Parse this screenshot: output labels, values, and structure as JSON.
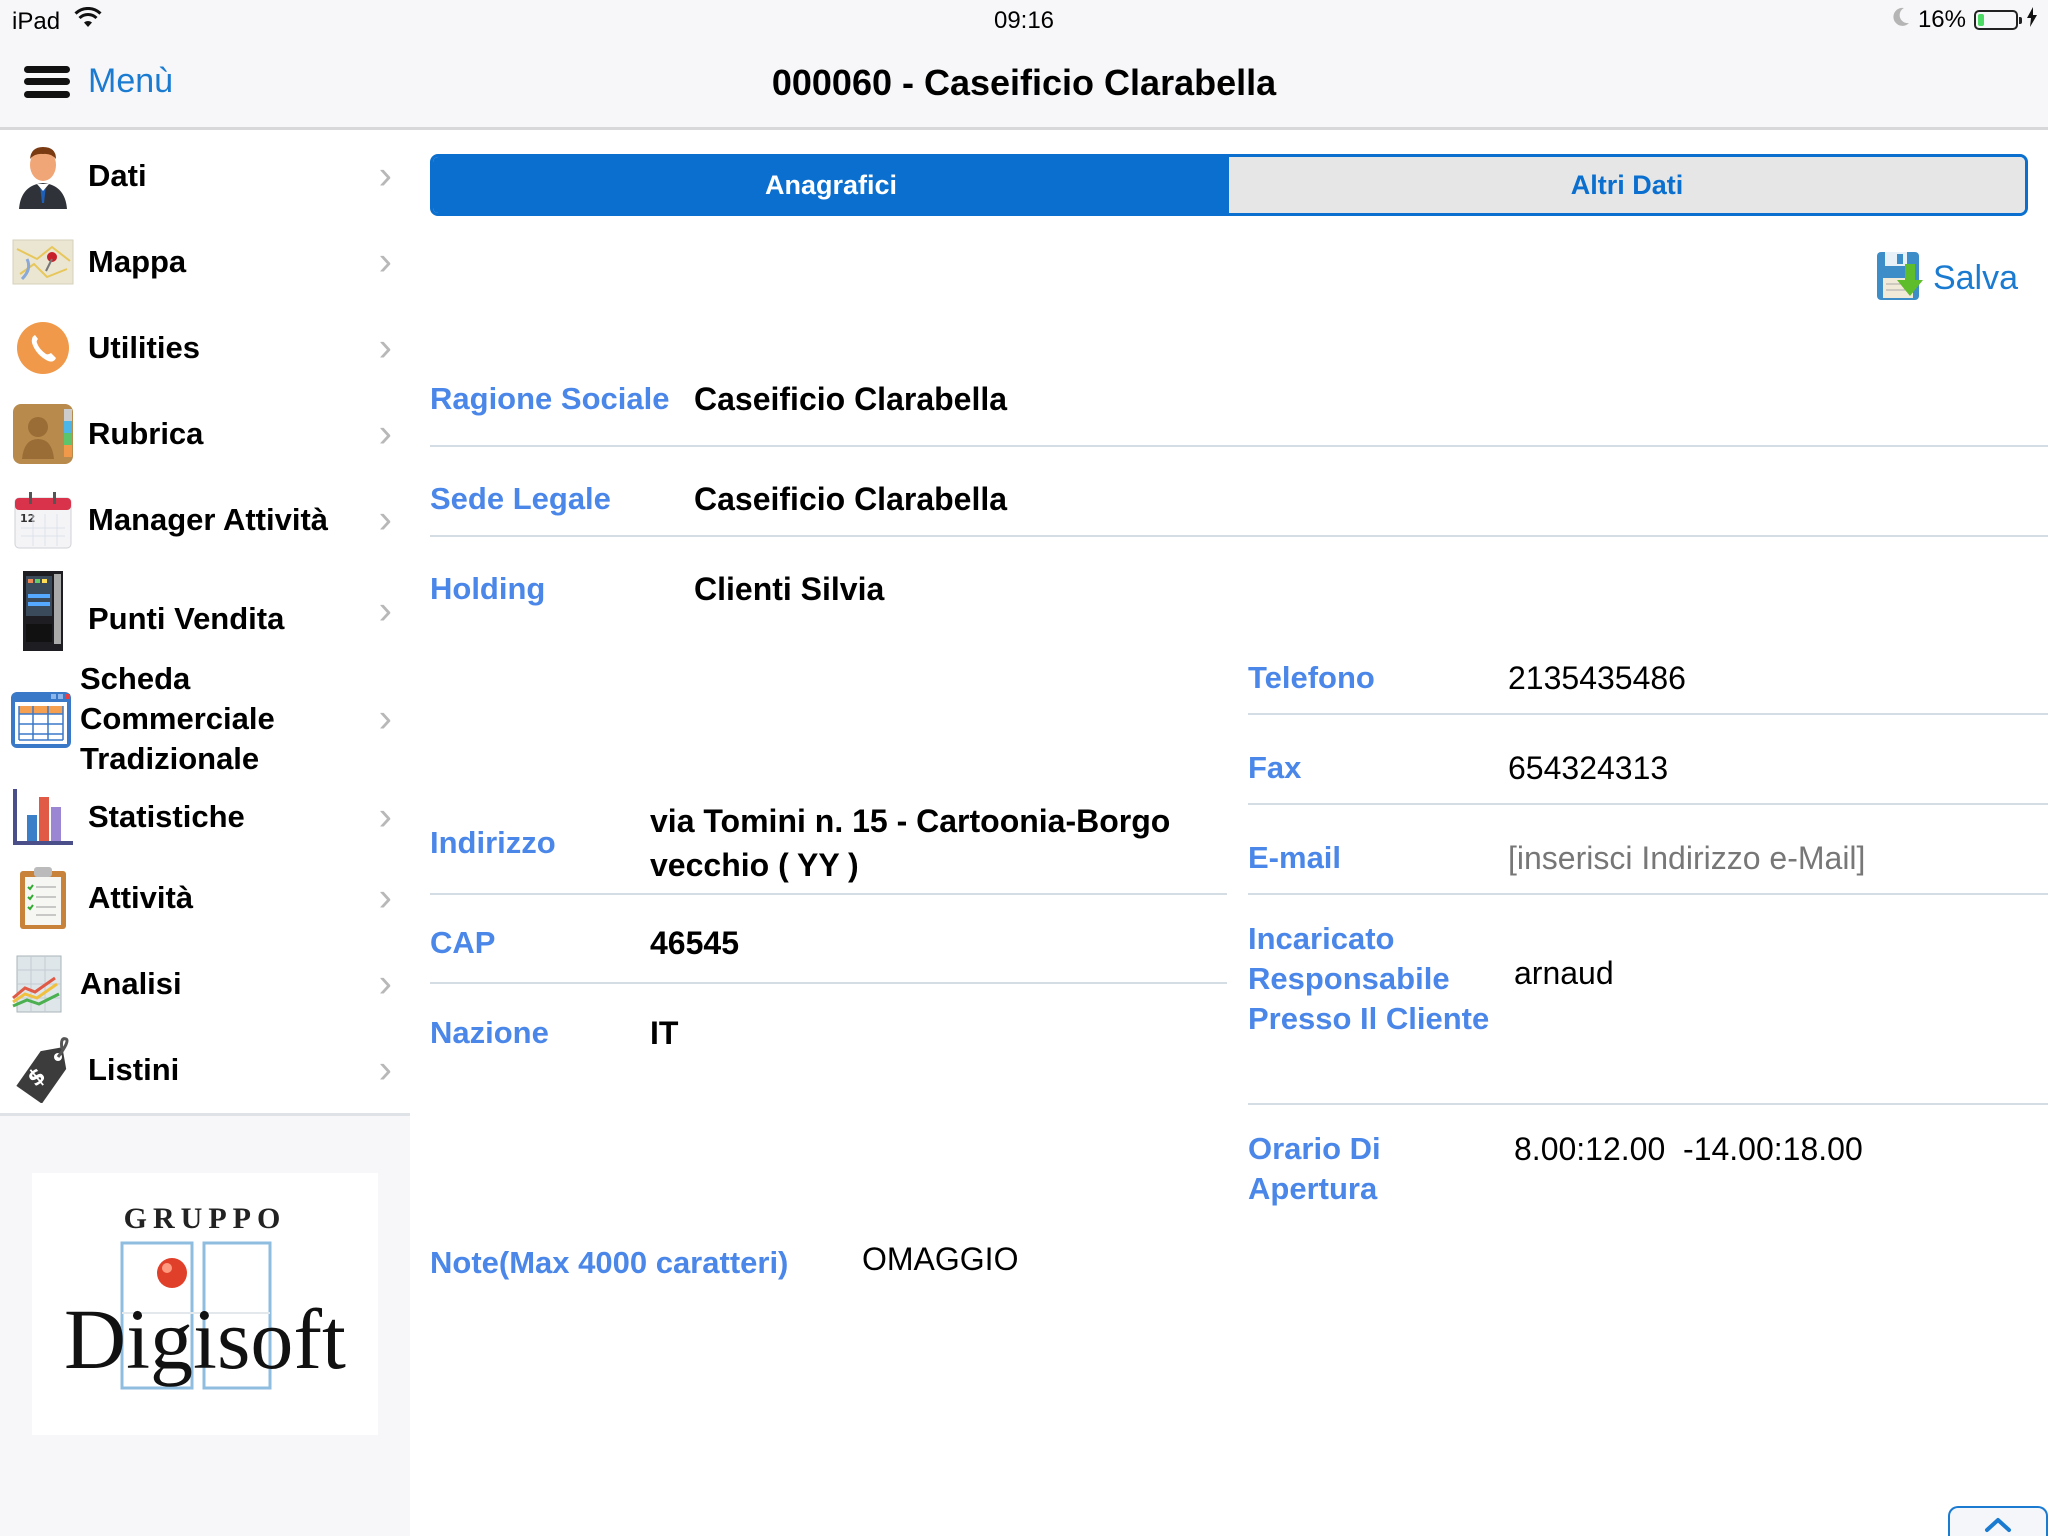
{
  "status_bar": {
    "device": "iPad",
    "time": "09:16",
    "battery_percent_label": "16%",
    "battery_level": 0.16,
    "icons": [
      "wifi-icon",
      "moon-icon",
      "battery-icon",
      "charging-bolt-icon"
    ]
  },
  "navbar": {
    "menu_label": "Menù",
    "title": "000060 - Caseificio Clarabella"
  },
  "sidebar": {
    "items": [
      {
        "label": "Dati",
        "icon": "person-icon"
      },
      {
        "label": "Mappa",
        "icon": "map-icon"
      },
      {
        "label": "Utilities",
        "icon": "phone-icon"
      },
      {
        "label": "Rubrica",
        "icon": "address-book-icon"
      },
      {
        "label": "Manager Attività",
        "icon": "calendar-icon"
      },
      {
        "label": "Punti Vendita",
        "icon": "vending-machine-icon"
      },
      {
        "label": "Scheda Commerciale Tradizionale",
        "icon": "spreadsheet-window-icon"
      },
      {
        "label": "Statistiche",
        "icon": "bar-chart-icon"
      },
      {
        "label": "Attività",
        "icon": "clipboard-icon"
      },
      {
        "label": "Analisi",
        "icon": "line-chart-icon"
      },
      {
        "label": "Listini",
        "icon": "price-tag-icon"
      }
    ],
    "logo": {
      "top_text": "GRUPPO",
      "main_text": "Digisoft"
    }
  },
  "tabs": [
    {
      "label": "Anagrafici",
      "active": true
    },
    {
      "label": "Altri Dati",
      "active": false
    }
  ],
  "save_label": "Salva",
  "fields": {
    "ragione_sociale": {
      "label": "Ragione Sociale",
      "value": "Caseificio Clarabella"
    },
    "sede_legale": {
      "label": "Sede Legale",
      "value": "Caseificio Clarabella"
    },
    "holding": {
      "label": "Holding",
      "value": "Clienti Silvia"
    },
    "indirizzo": {
      "label": "Indirizzo",
      "value": "via Tomini n. 15 - Cartoonia-Borgo vecchio ( YY )"
    },
    "cap": {
      "label": "CAP",
      "value": "46545"
    },
    "nazione": {
      "label": "Nazione",
      "value": "IT"
    },
    "telefono": {
      "label": "Telefono",
      "value": "2135435486"
    },
    "fax": {
      "label": "Fax",
      "value": "654324313"
    },
    "email": {
      "label": "E-mail",
      "value": "",
      "placeholder": "[inserisci Indirizzo e-Mail]"
    },
    "incaricato": {
      "label": "Incaricato Responsabile Presso Il Cliente",
      "value": "arnaud"
    },
    "orario": {
      "label": "Orario Di Apertura",
      "value": "8.00:12.00  -14.00:18.00"
    },
    "note": {
      "label": "Note(Max 4000 caratteri)",
      "value": "OMAGGIO"
    }
  },
  "colors": {
    "accent": "#0a6fce",
    "label_blue": "#4a87e8",
    "link_blue": "#1a7bd1",
    "tab_inactive_bg": "#e6e6e6"
  }
}
